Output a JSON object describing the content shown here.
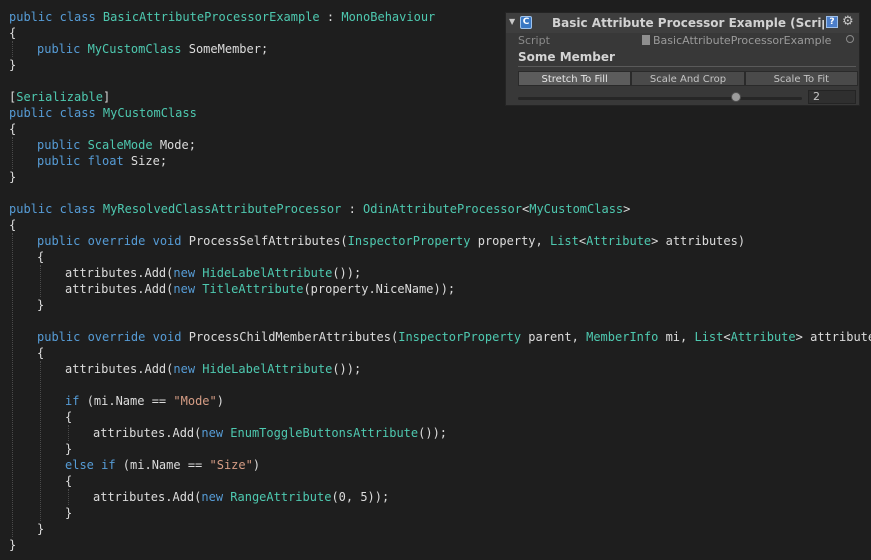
{
  "code": {
    "lines": [
      {
        "y": 1,
        "indent": 0,
        "tokens": [
          [
            "kw",
            "public class "
          ],
          [
            "type",
            "BasicAttributeProcessorExample"
          ],
          [
            "plain",
            " : "
          ],
          [
            "type",
            "MonoBehaviour"
          ]
        ]
      },
      {
        "y": 2,
        "indent": 0,
        "tokens": [
          [
            "plain",
            "{"
          ]
        ]
      },
      {
        "y": 3,
        "indent": 1,
        "tokens": [
          [
            "kw",
            "public "
          ],
          [
            "type",
            "MyCustomClass"
          ],
          [
            "plain",
            " SomeMember;"
          ]
        ]
      },
      {
        "y": 4,
        "indent": 0,
        "tokens": [
          [
            "plain",
            "}"
          ]
        ]
      },
      {
        "y": 6,
        "indent": 0,
        "tokens": [
          [
            "plain",
            "["
          ],
          [
            "type",
            "Serializable"
          ],
          [
            "plain",
            "]"
          ]
        ]
      },
      {
        "y": 7,
        "indent": 0,
        "tokens": [
          [
            "kw",
            "public class "
          ],
          [
            "type",
            "MyCustomClass"
          ]
        ]
      },
      {
        "y": 8,
        "indent": 0,
        "tokens": [
          [
            "plain",
            "{"
          ]
        ]
      },
      {
        "y": 9,
        "indent": 1,
        "tokens": [
          [
            "kw",
            "public "
          ],
          [
            "type",
            "ScaleMode"
          ],
          [
            "plain",
            " Mode;"
          ]
        ]
      },
      {
        "y": 10,
        "indent": 1,
        "tokens": [
          [
            "kw",
            "public float "
          ],
          [
            "plain",
            "Size;"
          ]
        ]
      },
      {
        "y": 11,
        "indent": 0,
        "tokens": [
          [
            "plain",
            "}"
          ]
        ]
      },
      {
        "y": 13,
        "indent": 0,
        "tokens": [
          [
            "kw",
            "public class "
          ],
          [
            "type",
            "MyResolvedClassAttributeProcessor"
          ],
          [
            "plain",
            " : "
          ],
          [
            "type",
            "OdinAttributeProcessor"
          ],
          [
            "plain",
            "<"
          ],
          [
            "type",
            "MyCustomClass"
          ],
          [
            "plain",
            ">"
          ]
        ]
      },
      {
        "y": 14,
        "indent": 0,
        "tokens": [
          [
            "plain",
            "{"
          ]
        ]
      },
      {
        "y": 15,
        "indent": 1,
        "tokens": [
          [
            "kw",
            "public override void "
          ],
          [
            "plain",
            "ProcessSelfAttributes("
          ],
          [
            "type",
            "InspectorProperty"
          ],
          [
            "plain",
            " property, "
          ],
          [
            "type",
            "List"
          ],
          [
            "plain",
            "<"
          ],
          [
            "type",
            "Attribute"
          ],
          [
            "plain",
            "> attributes)"
          ]
        ]
      },
      {
        "y": 16,
        "indent": 1,
        "tokens": [
          [
            "plain",
            "{"
          ]
        ]
      },
      {
        "y": 17,
        "indent": 2,
        "tokens": [
          [
            "plain",
            "attributes.Add("
          ],
          [
            "kw",
            "new "
          ],
          [
            "type",
            "HideLabelAttribute"
          ],
          [
            "plain",
            "());"
          ]
        ]
      },
      {
        "y": 18,
        "indent": 2,
        "tokens": [
          [
            "plain",
            "attributes.Add("
          ],
          [
            "kw",
            "new "
          ],
          [
            "type",
            "TitleAttribute"
          ],
          [
            "plain",
            "(property.NiceName));"
          ]
        ]
      },
      {
        "y": 19,
        "indent": 1,
        "tokens": [
          [
            "plain",
            "}"
          ]
        ]
      },
      {
        "y": 21,
        "indent": 1,
        "tokens": [
          [
            "kw",
            "public override void "
          ],
          [
            "plain",
            "ProcessChildMemberAttributes("
          ],
          [
            "type",
            "InspectorProperty"
          ],
          [
            "plain",
            " parent, "
          ],
          [
            "type",
            "MemberInfo"
          ],
          [
            "plain",
            " mi, "
          ],
          [
            "type",
            "List"
          ],
          [
            "plain",
            "<"
          ],
          [
            "type",
            "Attribute"
          ],
          [
            "plain",
            "> attributes)"
          ]
        ]
      },
      {
        "y": 22,
        "indent": 1,
        "tokens": [
          [
            "plain",
            "{"
          ]
        ]
      },
      {
        "y": 23,
        "indent": 2,
        "tokens": [
          [
            "plain",
            "attributes.Add("
          ],
          [
            "kw",
            "new "
          ],
          [
            "type",
            "HideLabelAttribute"
          ],
          [
            "plain",
            "());"
          ]
        ]
      },
      {
        "y": 25,
        "indent": 2,
        "tokens": [
          [
            "kw",
            "if "
          ],
          [
            "plain",
            "(mi.Name == "
          ],
          [
            "str",
            "\"Mode\""
          ],
          [
            "plain",
            ")"
          ]
        ]
      },
      {
        "y": 26,
        "indent": 2,
        "tokens": [
          [
            "plain",
            "{"
          ]
        ]
      },
      {
        "y": 27,
        "indent": 3,
        "tokens": [
          [
            "plain",
            "attributes.Add("
          ],
          [
            "kw",
            "new "
          ],
          [
            "type",
            "EnumToggleButtonsAttribute"
          ],
          [
            "plain",
            "());"
          ]
        ]
      },
      {
        "y": 28,
        "indent": 2,
        "tokens": [
          [
            "plain",
            "}"
          ]
        ]
      },
      {
        "y": 29,
        "indent": 2,
        "tokens": [
          [
            "kw",
            "else if "
          ],
          [
            "plain",
            "(mi.Name == "
          ],
          [
            "str",
            "\"Size\""
          ],
          [
            "plain",
            ")"
          ]
        ]
      },
      {
        "y": 30,
        "indent": 2,
        "tokens": [
          [
            "plain",
            "{"
          ]
        ]
      },
      {
        "y": 31,
        "indent": 3,
        "tokens": [
          [
            "plain",
            "attributes.Add("
          ],
          [
            "kw",
            "new "
          ],
          [
            "type",
            "RangeAttribute"
          ],
          [
            "plain",
            "(0, 5));"
          ]
        ]
      },
      {
        "y": 32,
        "indent": 2,
        "tokens": [
          [
            "plain",
            "}"
          ]
        ]
      },
      {
        "y": 33,
        "indent": 1,
        "tokens": [
          [
            "plain",
            "}"
          ]
        ]
      },
      {
        "y": 34,
        "indent": 0,
        "tokens": [
          [
            "plain",
            "}"
          ]
        ]
      }
    ]
  },
  "inspector": {
    "title": "Basic Attribute Processor Example (Script)",
    "script_label": "Script",
    "script_value": "BasicAttributeProcessorExample",
    "member_title": "Some Member",
    "scale_modes": [
      "Stretch To Fill",
      "Scale And Crop",
      "Scale To Fit"
    ],
    "selected_mode": 0,
    "size": {
      "value": "2",
      "min": 0,
      "max": 5
    },
    "icons": {
      "fold": "fold-arrow-icon",
      "script": "script-file-icon",
      "help": "help-icon",
      "gear": "gear-icon",
      "object_picker": "object-picker-icon"
    }
  },
  "colors": {
    "keyword": "#569cd6",
    "type": "#4ec9b0",
    "string": "#d69d85",
    "text": "#dcdcdc",
    "background": "#1e1e1e",
    "inspector_bg": "#383838"
  }
}
